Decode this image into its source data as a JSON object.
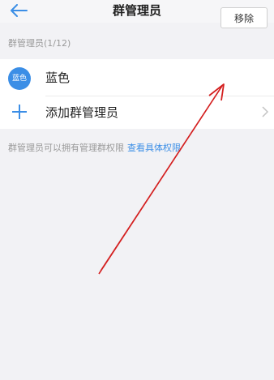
{
  "header": {
    "title": "群管理员"
  },
  "section": {
    "label": "群管理员(1/12)"
  },
  "admin": {
    "avatar_text": "蓝色",
    "name": "蓝色",
    "remove_label": "移除"
  },
  "add": {
    "label": "添加群管理员"
  },
  "note": {
    "text": "群管理员可以拥有管理群权限",
    "link": "查看具体权限"
  },
  "colors": {
    "accent": "#3b8ee6",
    "annotation": "#d42020"
  }
}
